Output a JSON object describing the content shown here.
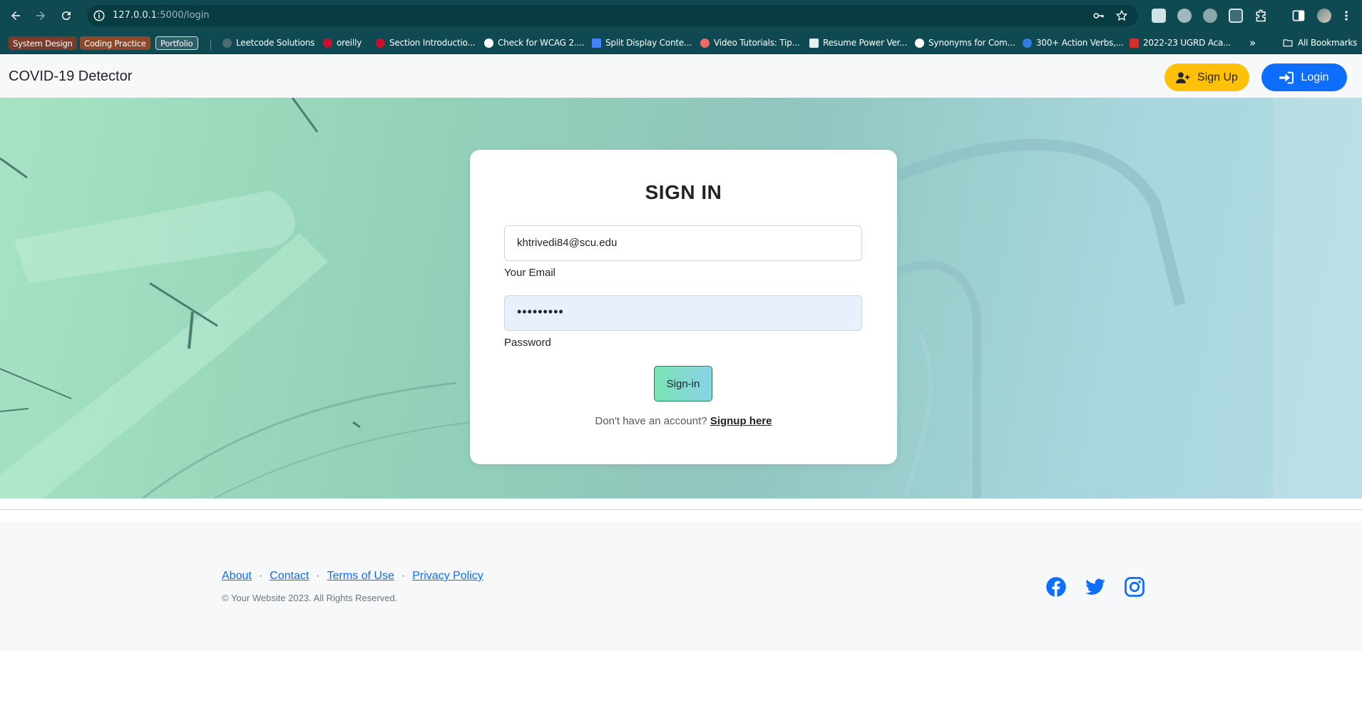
{
  "browser": {
    "url_host": "127.0.0.1",
    "url_path": ":5000/login",
    "bookmark_chips": [
      {
        "label": "System Design",
        "color": "#7a3d2c"
      },
      {
        "label": "Coding Practice",
        "color": "#8a4a2a"
      },
      {
        "label": "Portfolio",
        "color": "#2e5e66"
      }
    ],
    "bookmarks": [
      {
        "label": "Leetcode Solutions",
        "icon": "leetcode-favicon"
      },
      {
        "label": "oreilly",
        "icon": "oreilly-favicon"
      },
      {
        "label": "Section Introductio...",
        "icon": "oreilly-favicon"
      },
      {
        "label": "Check for WCAG 2....",
        "icon": "globe-icon"
      },
      {
        "label": "Split Display Conte...",
        "icon": "docs-icon"
      },
      {
        "label": "Video Tutorials: Tip...",
        "icon": "asana-icon"
      },
      {
        "label": "Resume Power Ver...",
        "icon": "pen-icon"
      },
      {
        "label": "Synonyms for Com...",
        "icon": "globe-icon"
      },
      {
        "label": "300+ Action Verbs,...",
        "icon": "bird-icon"
      },
      {
        "label": "2022-23 UGRD Aca...",
        "icon": "pdf-icon"
      }
    ],
    "all_bookmarks": "All Bookmarks",
    "more": "»"
  },
  "navbar": {
    "brand": "COVID-19 Detector",
    "signup_label": "Sign Up",
    "login_label": "Login",
    "signup_color": "#ffc107",
    "login_color": "#0d6efd"
  },
  "signin": {
    "title": "SIGN IN",
    "email_value": "khtrivedi84@scu.edu",
    "email_label": "Your Email",
    "password_value": "•••••••••",
    "password_label": "Password",
    "submit_label": "Sign-in",
    "no_account_text": "Don't have an account?",
    "signup_link": "Signup here"
  },
  "footer": {
    "links": [
      "About",
      "Contact",
      "Terms of Use",
      "Privacy Policy"
    ],
    "separator": "·",
    "copyright": "© Your Website 2023. All Rights Reserved.",
    "social": [
      "facebook-icon",
      "twitter-icon",
      "instagram-icon"
    ],
    "social_color": "#0d6efd"
  }
}
